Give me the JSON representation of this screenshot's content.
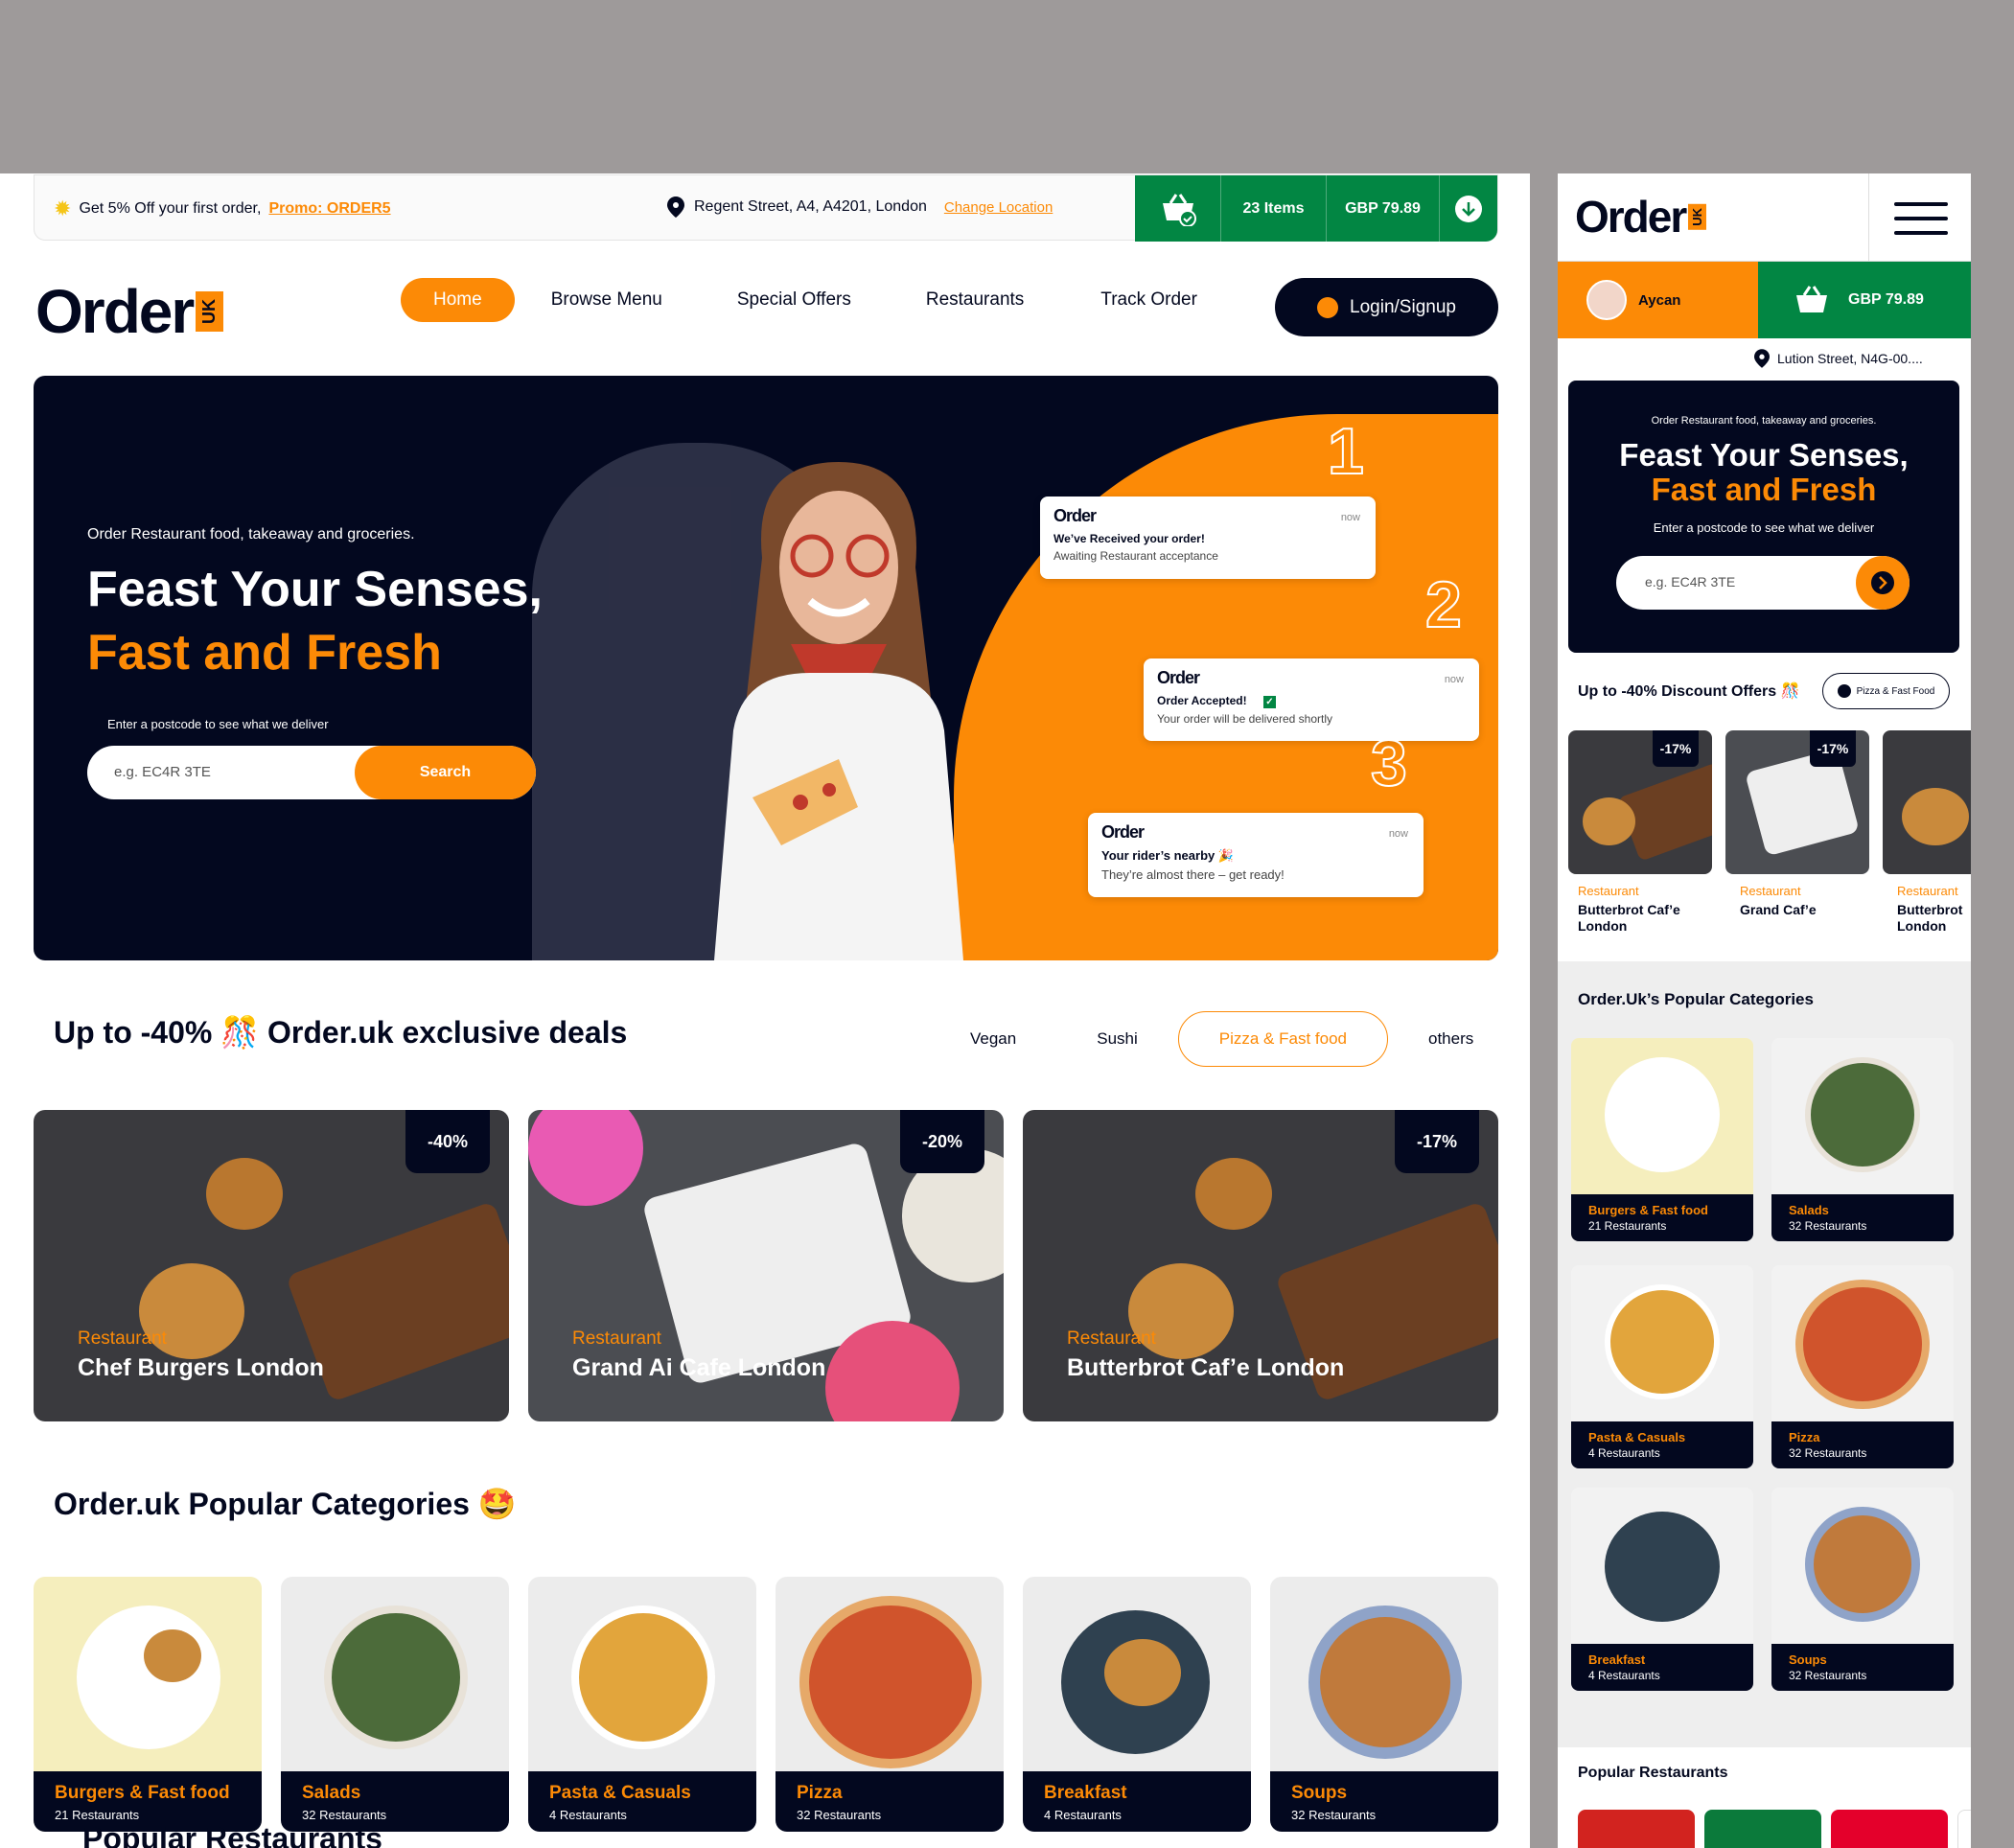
{
  "promo": {
    "text": "Get 5% Off your first order,",
    "code": "Promo: ORDER5"
  },
  "location": {
    "address": "Regent Street, A4, A4201, London",
    "change": "Change Location"
  },
  "cart": {
    "items": "23 Items",
    "total": "GBP 79.89"
  },
  "brand": {
    "name": "Order",
    "suffix": "UK"
  },
  "nav": {
    "items": [
      "Home",
      "Browse Menu",
      "Special Offers",
      "Restaurants",
      "Track Order"
    ],
    "login": "Login/Signup"
  },
  "hero": {
    "subtitle": "Order Restaurant food, takeaway and groceries.",
    "title_line1": "Feast Your Senses,",
    "title_line2": "Fast and Fresh",
    "postcode_label": "Enter a postcode to see what we deliver",
    "postcode_placeholder": "e.g. EC4R 3TE",
    "search_label": "Search",
    "notifications": [
      {
        "num": "1",
        "logo": "Order",
        "time": "now",
        "title": "We’ve Received your order!",
        "desc": "Awaiting Restaurant acceptance"
      },
      {
        "num": "2",
        "logo": "Order",
        "time": "now",
        "title": "Order Accepted!",
        "desc": "Your order will be delivered shortly"
      },
      {
        "num": "3",
        "logo": "Order",
        "time": "now",
        "title": "Your rider’s nearby 🎉",
        "desc": "They’re almost there – get ready!"
      }
    ]
  },
  "deals": {
    "title": "Up to -40% 🎊 Order.uk exclusive deals",
    "filters": [
      "Vegan",
      "Sushi",
      "Pizza & Fast food",
      "others"
    ],
    "active_filter": "Pizza & Fast food",
    "cards": [
      {
        "discount": "-40%",
        "label": "Restaurant",
        "name": "Chef Burgers London"
      },
      {
        "discount": "-20%",
        "label": "Restaurant",
        "name": "Grand Ai Cafe London"
      },
      {
        "discount": "-17%",
        "label": "Restaurant",
        "name": "Butterbrot Caf’e London"
      }
    ]
  },
  "categories": {
    "title": "Order.uk Popular Categories 🤩",
    "items": [
      {
        "name": "Burgers & Fast food",
        "count": "21 Restaurants"
      },
      {
        "name": "Salads",
        "count": "32 Restaurants"
      },
      {
        "name": "Pasta & Casuals",
        "count": "4 Restaurants"
      },
      {
        "name": "Pizza",
        "count": "32 Restaurants"
      },
      {
        "name": "Breakfast",
        "count": "4 Restaurants"
      },
      {
        "name": "Soups",
        "count": "32 Restaurants"
      }
    ]
  },
  "popular_restaurants_title": "Popular Restaurants",
  "mobile": {
    "user": "Aycan",
    "cart_total": "GBP 79.89",
    "location": "Lution Street, N4G-00....",
    "hero_subtitle": "Order Restaurant food, takeaway and groceries.",
    "hero_line1": "Feast Your Senses,",
    "hero_line2": "Fast and Fresh",
    "postcode_label": "Enter a postcode to see what we deliver",
    "postcode_placeholder": "e.g. EC4R 3TE",
    "deals_title": "Up to -40% Discount Offers 🎊",
    "chip": "Pizza & Fast Food",
    "deal_cards": [
      {
        "discount": "-17%",
        "label": "Restaurant",
        "name": "Butterbrot Caf’e London"
      },
      {
        "discount": "-17%",
        "label": "Restaurant",
        "name": "Grand Caf’e"
      },
      {
        "discount": "",
        "label": "Restaurant",
        "name": "Butterbrot London"
      }
    ],
    "categories_title": "Order.Uk’s Popular Categories",
    "categories": [
      {
        "name": "Burgers & Fast food",
        "count": "21 Restaurants"
      },
      {
        "name": "Salads",
        "count": "32 Restaurants"
      },
      {
        "name": "Pasta & Casuals",
        "count": "4 Restaurants"
      },
      {
        "name": "Pizza",
        "count": "32 Restaurants"
      },
      {
        "name": "Breakfast",
        "count": "4 Restaurants"
      },
      {
        "name": "Soups",
        "count": "32 Restaurants"
      }
    ],
    "popular_restaurants_title": "Popular Restaurants"
  },
  "colors": {
    "accent": "#FC8A06",
    "dark": "#03081F",
    "green": "#028643"
  }
}
